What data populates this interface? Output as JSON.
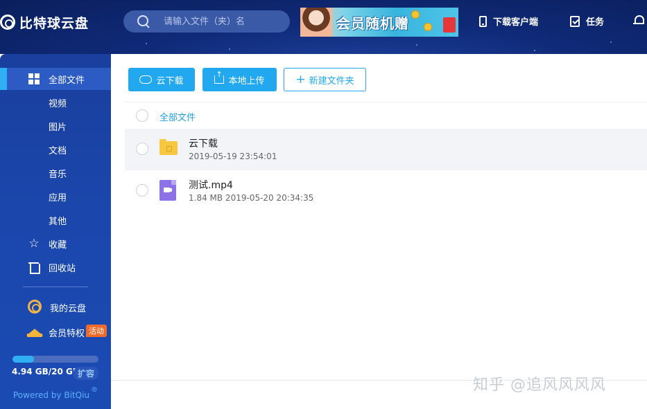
{
  "app": {
    "logo_text": "比特球云盘"
  },
  "search": {
    "placeholder": "请输入文件（夹）名"
  },
  "banner": {
    "text": "会员随机赠"
  },
  "top_actions": {
    "download_client": "下载客户端",
    "tasks": "任务"
  },
  "sidebar": {
    "items": [
      {
        "label": "全部文件",
        "icon": "grid-icon",
        "active": true
      },
      {
        "label": "视频"
      },
      {
        "label": "图片"
      },
      {
        "label": "文档"
      },
      {
        "label": "音乐"
      },
      {
        "label": "应用"
      },
      {
        "label": "其他"
      },
      {
        "label": "收藏",
        "icon": "star-icon"
      },
      {
        "label": "回收站",
        "icon": "trash-icon"
      }
    ],
    "my_cloud": "我的云盘",
    "vip": "会员特权",
    "vip_badge": "活动",
    "storage": {
      "text": "4.94 GB/20 GB",
      "used_fraction": 0.247,
      "expand": "扩容"
    },
    "powered_by": "Powered by BitQiu",
    "registered": "®"
  },
  "toolbar": {
    "cloud_download": "云下载",
    "local_upload": "本地上传",
    "new_folder": "新建文件夹"
  },
  "breadcrumb": {
    "root": "全部文件"
  },
  "files": [
    {
      "name": "云下载",
      "meta": "2019-05-19 23:54:01",
      "type": "folder"
    },
    {
      "name": "测试.mp4",
      "meta": "1.84 MB   2019-05-20 20:34:35",
      "type": "video"
    }
  ],
  "watermark": "知乎 @追风风风风",
  "colors": {
    "accent": "#21a8ef",
    "sidebar": "#1b47ad",
    "topbar": "#0f2a78"
  }
}
